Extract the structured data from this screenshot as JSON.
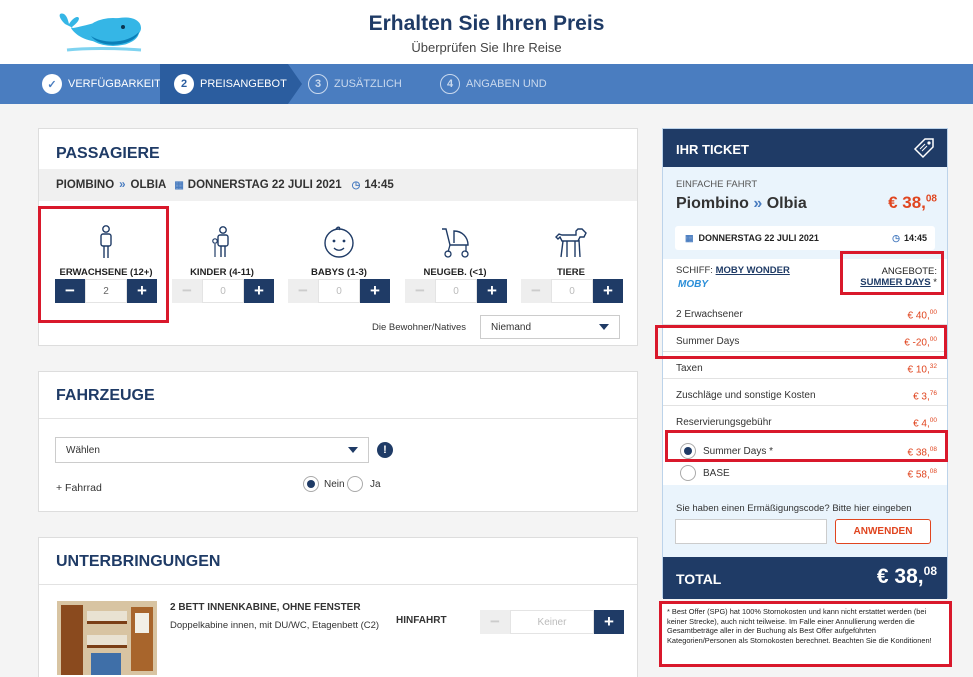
{
  "header": {
    "title": "Erhalten Sie Ihren Preis",
    "subtitle": "Überprüfen Sie Ihre Reise"
  },
  "steps": [
    {
      "num": "✓",
      "label": "VERFÜGBARKEIT"
    },
    {
      "num": "2",
      "label": "PREISANGEBOT"
    },
    {
      "num": "3",
      "label": "ZUSÄTZLICH"
    },
    {
      "num": "4",
      "label": "ANGABEN UND"
    }
  ],
  "passengers": {
    "title": "PASSAGIERE",
    "route": {
      "from": "PIOMBINO",
      "arrow": "»",
      "to": "OLBIA",
      "date": "DONNERSTAG 22 JULI 2021",
      "time": "14:45"
    },
    "types": [
      {
        "label": "ERWACHSENE (12+)",
        "count": "2",
        "icon": "adult-icon"
      },
      {
        "label": "KINDER (4-11)",
        "count": "0",
        "icon": "child-icon"
      },
      {
        "label": "BABYS (1-3)",
        "count": "0",
        "icon": "baby-icon"
      },
      {
        "label": "NEUGEB. (<1)",
        "count": "0",
        "icon": "stroller-icon"
      },
      {
        "label": "TIERE",
        "count": "0",
        "icon": "dog-icon"
      }
    ],
    "residents_label": "Die Bewohner/Natives",
    "residents_value": "Niemand"
  },
  "vehicles": {
    "title": "FAHRZEUGE",
    "select_value": "Wählen",
    "info": "!",
    "bike_label": "+ Fahrrad",
    "no": "Nein",
    "yes": "Ja"
  },
  "accommodation": {
    "title": "UNTERBRINGUNGEN",
    "cabin_title": "2 BETT INNENKABINE, OHNE FENSTER",
    "cabin_desc": "Doppelkabine innen, mit DU/WC, Etagenbett (C2)",
    "direction": "HINFAHRT",
    "value": "Keiner"
  },
  "ticket": {
    "title": "IHR TICKET",
    "trip_type": "EINFACHE FAHRT",
    "from": "Piombino",
    "arrow": "»",
    "to": "Olbia",
    "price_main": "€ 38,",
    "price_cents": "08",
    "date": "DONNERSTAG 22 JULI 2021",
    "time": "14:45",
    "ship_label": "SCHIFF:",
    "ship_name": "MOBY WONDER",
    "brand": "MOBY",
    "offers_label": "ANGEBOTE:",
    "offers_value": "SUMMER DAYS",
    "offers_star": "*",
    "lines": [
      {
        "label": "2 Erwachsener",
        "value": "€ 40,",
        "cents": "00"
      },
      {
        "label": "Summer Days",
        "value": "€ -20,",
        "cents": "00"
      },
      {
        "label": "Taxen",
        "value": "€ 10,",
        "cents": "32"
      },
      {
        "label": "Zuschläge und sonstige Kosten",
        "value": "€ 3,",
        "cents": "76"
      },
      {
        "label": "Reservierungsgebühr",
        "value": "€ 4,",
        "cents": "00"
      }
    ],
    "fares": [
      {
        "label": "Summer Days *",
        "value": "€ 38,",
        "cents": "08",
        "selected": true
      },
      {
        "label": "BASE",
        "value": "€ 58,",
        "cents": "08",
        "selected": false
      }
    ],
    "discount_prompt": "Sie haben einen Ermäßigungscode? Bitte hier eingeben",
    "apply_label": "ANWENDEN",
    "total_label": "TOTAL",
    "total_main": "€ 38,",
    "total_cents": "08"
  },
  "note": "* Best Offer (SPG) hat 100% Stornokosten und kann nicht erstattet werden (bei keiner Strecke), auch nicht teilweise. Im Falle einer Annullierung werden die Gesamtbeträge aller in der Buchung als Best Offer aufgeführten Kategorien/Personen als Stornokosten berechnet. Beachten Sie die Konditionen!",
  "colors": {
    "navy": "#1f3b66",
    "blue": "#4a7dc0",
    "orange": "#e0451f",
    "red": "#d9182b"
  }
}
